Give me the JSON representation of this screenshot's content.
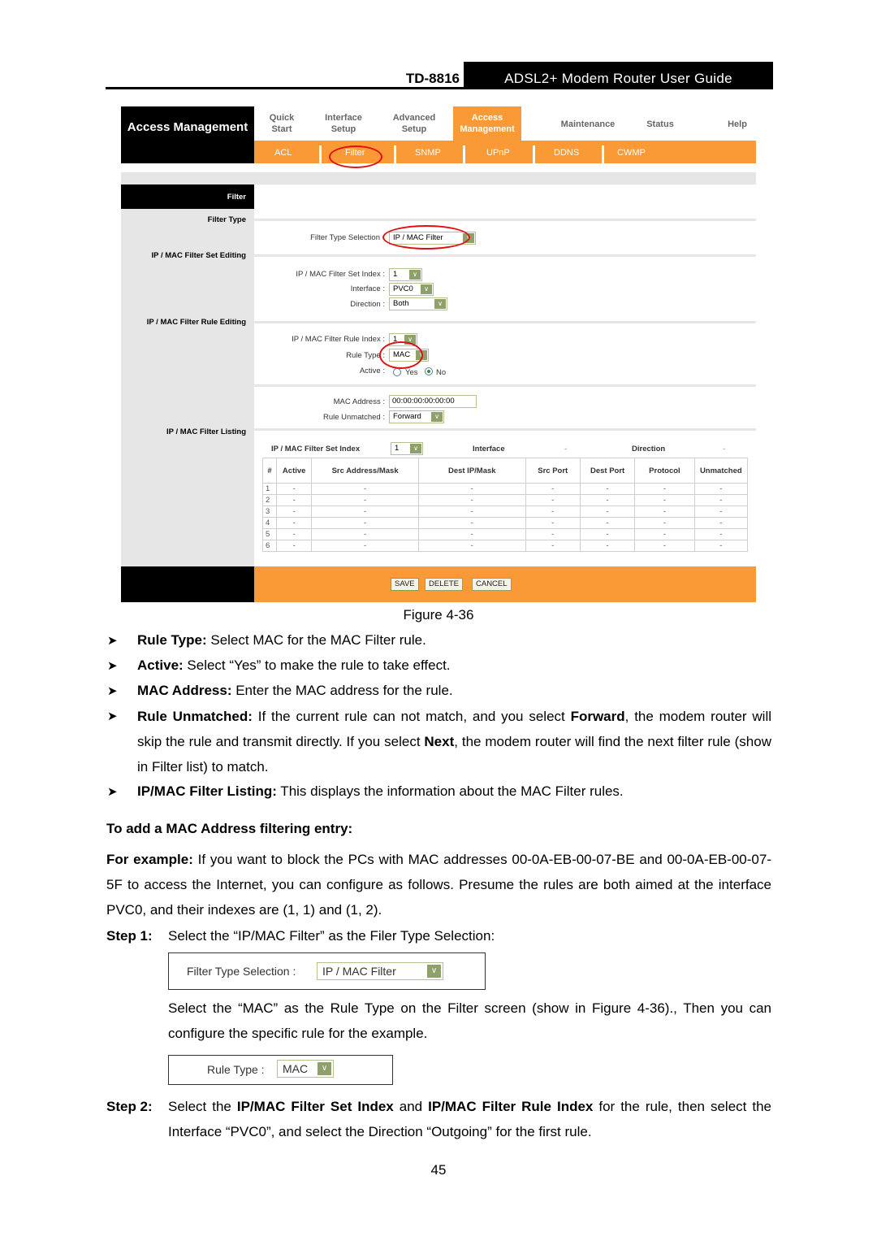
{
  "header": {
    "model": "TD-8816",
    "guide_title": "ADSL2+ Modem Router User Guide"
  },
  "figure": {
    "brand": "Access Management",
    "top_nav": [
      {
        "label": "Quick Start",
        "active": false
      },
      {
        "label": "Interface Setup",
        "active": false
      },
      {
        "label": "Advanced Setup",
        "active": false
      },
      {
        "label": "Access Management",
        "active": true
      },
      {
        "label": "Maintenance",
        "active": false
      },
      {
        "label": "Status",
        "active": false
      },
      {
        "label": "Help",
        "active": false
      }
    ],
    "sub_nav": [
      "ACL",
      "Filter",
      "SNMP",
      "UPnP",
      "DDNS",
      "CWMP"
    ],
    "highlighted_sub_nav": "Filter",
    "sidebar": {
      "title": "Filter",
      "sections": [
        "Filter Type",
        "IP / MAC Filter Set Editing",
        "IP / MAC Filter Rule Editing",
        "IP / MAC Filter Listing"
      ]
    },
    "filter_type": {
      "label": "Filter Type Selection",
      "value": "IP / MAC Filter"
    },
    "set_editing": {
      "set_index_label": "IP / MAC Filter Set Index :",
      "set_index_value": "1",
      "interface_label": "Interface :",
      "interface_value": "PVC0",
      "direction_label": "Direction :",
      "direction_value": "Both"
    },
    "rule_editing": {
      "rule_index_label": "IP / MAC Filter Rule Index :",
      "rule_index_value": "1",
      "rule_type_label": "Rule Type :",
      "rule_type_value": "MAC",
      "active_label": "Active :",
      "active_options": [
        "Yes",
        "No"
      ],
      "active_selected": "No",
      "mac_label": "MAC Address :",
      "mac_value": "00:00:00:00:00:00",
      "unmatched_label": "Rule Unmatched :",
      "unmatched_value": "Forward"
    },
    "listing": {
      "set_index_label": "IP / MAC Filter Set Index",
      "set_index_value": "1",
      "interface_label": "Interface",
      "interface_value": "-",
      "direction_label": "Direction",
      "direction_value": "-",
      "columns": [
        "#",
        "Active",
        "Src Address/Mask",
        "Dest IP/Mask",
        "Src Port",
        "Dest Port",
        "Protocol",
        "Unmatched"
      ],
      "rows": [
        [
          "1",
          "-",
          "-",
          "-",
          "-",
          "-",
          "-",
          "-"
        ],
        [
          "2",
          "-",
          "-",
          "-",
          "-",
          "-",
          "-",
          "-"
        ],
        [
          "3",
          "-",
          "-",
          "-",
          "-",
          "-",
          "-",
          "-"
        ],
        [
          "4",
          "-",
          "-",
          "-",
          "-",
          "-",
          "-",
          "-"
        ],
        [
          "5",
          "-",
          "-",
          "-",
          "-",
          "-",
          "-",
          "-"
        ],
        [
          "6",
          "-",
          "-",
          "-",
          "-",
          "-",
          "-",
          "-"
        ]
      ]
    },
    "buttons": {
      "save": "SAVE",
      "delete": "DELETE",
      "cancel": "CANCEL"
    },
    "annotation_color": "#e01010",
    "accent_color": "#f99a37"
  },
  "caption": "Figure 4-36",
  "bullets": [
    {
      "term": "Rule Type:",
      "text": " Select MAC for the MAC Filter rule."
    },
    {
      "term": "Active:",
      "text": " Select “Yes” to make the rule to take effect."
    },
    {
      "term": "MAC Address:",
      "text": " Enter the MAC address for the rule."
    },
    {
      "term": "Rule Unmatched:",
      "text_1": " If the current rule can not match, and you select ",
      "bold_1": "Forward",
      "text_2": ", the modem router will skip the rule and transmit directly. If you select ",
      "bold_2": "Next",
      "text_3": ", the modem router will find the next filter rule (show in Filter list) to match."
    },
    {
      "term": "IP/MAC Filter Listing:",
      "text": " This displays the information about the MAC Filter rules."
    }
  ],
  "section_heading": "To add a MAC Address filtering entry:",
  "example": {
    "term": "For example:",
    "text": " If you want to block the PCs with MAC addresses 00-0A-EB-00-07-BE and 00-0A-EB-00-07-5F to access the Internet, you can configure as follows. Presume the rules are both aimed at the interface PVC0, and their indexes are (1, 1) and (1, 2)."
  },
  "step1": {
    "label": "Step 1:",
    "text": "Select the “IP/MAC Filter” as the Filer Type Selection:",
    "mini_label": "Filter Type Selection :",
    "mini_value": "IP / MAC Filter",
    "followup": "Select the “MAC” as the Rule Type on the Filter screen (show in Figure 4-36)., Then you can configure the specific rule for the example.",
    "mini2_label": "Rule Type :",
    "mini2_value": "MAC"
  },
  "step2": {
    "label": "Step 2:",
    "t1": "Select the ",
    "b1": "IP/MAC Filter Set Index",
    "t2": " and ",
    "b2": "IP/MAC Filter Rule Index",
    "t3": " for the rule, then select the Interface “PVC0”, and select the Direction “Outgoing” for the first rule."
  },
  "page_number": "45"
}
